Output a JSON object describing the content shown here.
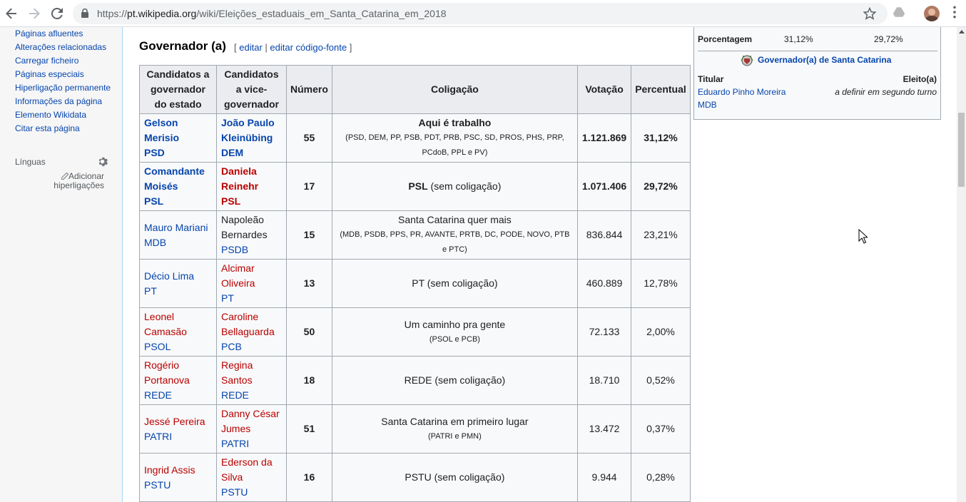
{
  "browser": {
    "url_prefix": "https://",
    "url_host": "pt.wikipedia.org",
    "url_path": "/wiki/Eleições_estaduais_em_Santa_Catarina_em_2018"
  },
  "sidebar": {
    "links": [
      "Páginas afluentes",
      "Alterações relacionadas",
      "Carregar ficheiro",
      "Páginas especiais",
      "Hiperligação permanente",
      "Informações da página",
      "Elemento Wikidata",
      "Citar esta página"
    ],
    "languages_heading": "Línguas",
    "add_links": "Adicionar hiperligações"
  },
  "section": {
    "title": "Governador (a)",
    "bracket_open": "[",
    "edit": "editar",
    "separator": "|",
    "edit_source": "editar código-fonte",
    "bracket_close": "]"
  },
  "table": {
    "headers": [
      "Candidatos a governador do estado",
      "Candidatos a vice-governador",
      "Número",
      "Coligação",
      "Votação",
      "Percentual"
    ],
    "rows": [
      {
        "candidate": [
          "Gelson Merisio",
          "PSD"
        ],
        "vice": [
          "João Paulo",
          "Kleinübing",
          "DEM"
        ],
        "number": "55",
        "coalition_name": "Aqui é trabalho",
        "coalition_parties": "(PSD, DEM, PP, PSB, PDT, PRB, PSC, SD, PROS, PHS, PRP, PCdoB, PPL e PV)",
        "coalition_note": "",
        "votes": "1.121.869",
        "percent": "31,12%",
        "bold": true,
        "cand_color": "blue",
        "vice_color": "blue"
      },
      {
        "candidate": [
          "Comandante",
          "Moisés",
          "PSL"
        ],
        "vice": [
          "Daniela",
          "Reinehr",
          "PSL"
        ],
        "number": "17",
        "coalition_name": "PSL",
        "coalition_parties": "",
        "coalition_note": "(sem coligação)",
        "votes": "1.071.406",
        "percent": "29,72%",
        "bold": true,
        "cand_color": "blue",
        "vice_color": "red"
      },
      {
        "candidate": [
          "Mauro Mariani",
          "MDB"
        ],
        "vice": [
          "Napoleão",
          "Bernardes",
          "PSDB"
        ],
        "number": "15",
        "coalition_name": "Santa Catarina quer mais",
        "coalition_parties": "(MDB, PSDB, PPS, PR, AVANTE, PRTB, DC, PODE, NOVO, PTB e PTC)",
        "coalition_note": "",
        "votes": "836.844",
        "percent": "23,21%",
        "bold": false,
        "cand_color": "blue",
        "vice_color": "mixed"
      },
      {
        "candidate": [
          "Décio Lima",
          "PT"
        ],
        "vice": [
          "Alcimar",
          "Oliveira",
          "PT"
        ],
        "number": "13",
        "coalition_name": "PT (sem coligação)",
        "coalition_parties": "",
        "coalition_note": "",
        "votes": "460.889",
        "percent": "12,78%",
        "bold": false,
        "cand_color": "blue",
        "vice_color": "red-blue"
      },
      {
        "candidate": [
          "Leonel",
          "Camasão",
          "PSOL"
        ],
        "vice": [
          "Caroline",
          "Bellaguarda",
          "PCB"
        ],
        "number": "50",
        "coalition_name": "Um caminho pra gente",
        "coalition_parties": "(PSOL e PCB)",
        "coalition_note": "",
        "votes": "72.133",
        "percent": "2,00%",
        "bold": false,
        "cand_color": "red-blue",
        "vice_color": "red-blue"
      },
      {
        "candidate": [
          "Rogério",
          "Portanova",
          "REDE"
        ],
        "vice": [
          "Regina",
          "Santos",
          "REDE"
        ],
        "number": "18",
        "coalition_name": "REDE (sem coligação)",
        "coalition_parties": "",
        "coalition_note": "",
        "votes": "18.710",
        "percent": "0,52%",
        "bold": false,
        "cand_color": "red-blue",
        "vice_color": "red-blue"
      },
      {
        "candidate": [
          "Jessé Pereira",
          "PATRI"
        ],
        "vice": [
          "Danny César",
          "Jumes",
          "PATRI"
        ],
        "number": "51",
        "coalition_name": "Santa Catarina em primeiro lugar",
        "coalition_parties": "(PATRI e PMN)",
        "coalition_note": "",
        "votes": "13.472",
        "percent": "0,37%",
        "bold": false,
        "cand_color": "red-blue",
        "vice_color": "red-blue"
      },
      {
        "candidate": [
          "Ingrid Assis",
          "PSTU"
        ],
        "vice": [
          "Ederson da",
          "Silva",
          "PSTU"
        ],
        "number": "16",
        "coalition_name": "PSTU (sem coligação)",
        "coalition_parties": "",
        "coalition_note": "",
        "votes": "9.944",
        "percent": "0,28%",
        "bold": false,
        "cand_color": "red-blue",
        "vice_color": "red-blue"
      }
    ]
  },
  "infobox": {
    "pct_label": "Porcentagem",
    "pct_1": "31,12%",
    "pct_2": "29,72%",
    "governor_link": "Governador(a) de Santa Catarina",
    "titular_label": "Titular",
    "eleito_label": "Eleito(a)",
    "titular_name": "Eduardo Pinho Moreira",
    "titular_party": "MDB",
    "eleito_value": "a definir em segundo turno"
  },
  "colors": {
    "link_blue": "#0645ad",
    "redlink": "#ba0000",
    "header_bg": "#eaecf0",
    "border": "#a2a9b1"
  },
  "icons": [
    "back-arrow-icon",
    "forward-arrow-icon",
    "reload-icon",
    "lock-icon",
    "star-icon",
    "drive-icon",
    "menu-dots-icon",
    "gear-icon",
    "pencil-icon",
    "seal-icon",
    "mouse-cursor-icon"
  ]
}
